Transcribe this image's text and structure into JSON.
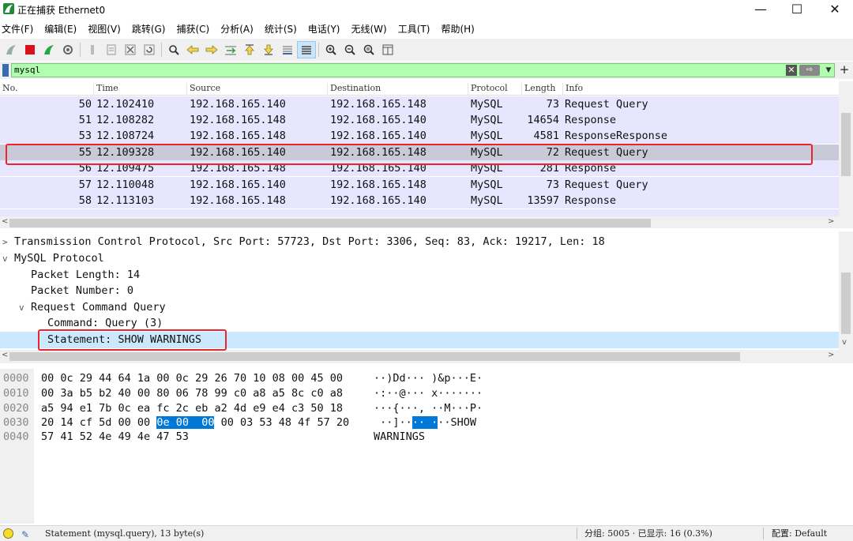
{
  "window": {
    "title": "正在捕获 Ethernet0",
    "minimize": "—",
    "maximize": "☐",
    "close": "✕"
  },
  "menu": [
    "文件(F)",
    "编辑(E)",
    "视图(V)",
    "跳转(G)",
    "捕获(C)",
    "分析(A)",
    "统计(S)",
    "电话(Y)",
    "无线(W)",
    "工具(T)",
    "帮助(H)"
  ],
  "toolbar": {
    "icons": [
      "shark-fin-start-icon",
      "stop-capture-icon",
      "restart-capture-icon",
      "capture-options-icon",
      "open-file-icon",
      "save-file-icon",
      "close-file-icon",
      "reload-icon",
      "find-packet-icon",
      "go-back-icon",
      "go-forward-icon",
      "go-to-packet-icon",
      "first-packet-icon",
      "last-packet-icon",
      "autoscroll-icon",
      "colorize-icon",
      "zoom-in-icon",
      "zoom-out-icon",
      "zoom-normal-icon",
      "resize-columns-icon"
    ]
  },
  "filter": {
    "value": "mysql"
  },
  "packet_list": {
    "columns": [
      "No.",
      "Time",
      "Source",
      "Destination",
      "Protocol",
      "Length",
      "Info"
    ],
    "rows": [
      {
        "no": "50",
        "time": "12.102410",
        "src": "192.168.165.140",
        "dst": "192.168.165.148",
        "proto": "MySQL",
        "len": "73",
        "info": "Request Query"
      },
      {
        "no": "51",
        "time": "12.108282",
        "src": "192.168.165.148",
        "dst": "192.168.165.140",
        "proto": "MySQL",
        "len": "14654",
        "info": "Response"
      },
      {
        "no": "53",
        "time": "12.108724",
        "src": "192.168.165.148",
        "dst": "192.168.165.140",
        "proto": "MySQL",
        "len": "4581",
        "info": "ResponseResponse"
      },
      {
        "no": "55",
        "time": "12.109328",
        "src": "192.168.165.140",
        "dst": "192.168.165.148",
        "proto": "MySQL",
        "len": "72",
        "info": "Request Query"
      },
      {
        "no": "56",
        "time": "12.109475",
        "src": "192.168.165.148",
        "dst": "192.168.165.140",
        "proto": "MySQL",
        "len": "281",
        "info": "Response"
      },
      {
        "no": "57",
        "time": "12.110048",
        "src": "192.168.165.140",
        "dst": "192.168.165.148",
        "proto": "MySQL",
        "len": "73",
        "info": "Request Query"
      },
      {
        "no": "58",
        "time": "12.113103",
        "src": "192.168.165.148",
        "dst": "192.168.165.140",
        "proto": "MySQL",
        "len": "13597",
        "info": "Response"
      }
    ],
    "selected_row": 3
  },
  "details": {
    "lines": [
      {
        "twisty": ">",
        "text": "Transmission Control Protocol, Src Port: 57723, Dst Port: 3306, Seq: 83, Ack: 19217, Len: 18"
      },
      {
        "twisty": "v",
        "text": "MySQL Protocol"
      },
      {
        "twisty": "",
        "text": "Packet Length: 14"
      },
      {
        "twisty": "",
        "text": "Packet Number: 0"
      },
      {
        "twisty": "v",
        "text": "Request Command Query"
      },
      {
        "twisty": "",
        "text": "Command: Query (3)"
      },
      {
        "twisty": "",
        "text": "Statement: SHOW WARNINGS"
      }
    ]
  },
  "bytes": {
    "rows": [
      {
        "offset": "0000",
        "hex_a": "00 0c 29 44 64 1a 00 0c  29 26 70 10 08 00 45 00",
        "hex_hl": "",
        "hex_b": "",
        "ascii_a": "··)Dd··· )&p···E·",
        "ascii_hl": "",
        "ascii_b": ""
      },
      {
        "offset": "0010",
        "hex_a": "00 3a b5 b2 40 00 80 06  78 99 c0 a8 a5 8c c0 a8",
        "hex_hl": "",
        "hex_b": "",
        "ascii_a": "·:··@··· x·······",
        "ascii_hl": "",
        "ascii_b": ""
      },
      {
        "offset": "0020",
        "hex_a": "a5 94 e1 7b 0c ea fc 2c  eb a2 4d e9 e4 c3 50 18",
        "hex_hl": "",
        "hex_b": "",
        "ascii_a": "···{···, ··M···P·",
        "ascii_hl": "",
        "ascii_b": ""
      },
      {
        "offset": "0030",
        "hex_a": "20 14 cf 5d 00 00 ",
        "hex_hl": "0e 00  00",
        "hex_b": " 00 03 53 48 4f 57 20",
        "ascii_a": " ··]··",
        "ascii_hl": "·· ·",
        "ascii_b": "··SHOW "
      },
      {
        "offset": "0040",
        "hex_a": "57 41 52 4e 49 4e 47 53",
        "hex_hl": "",
        "hex_b": "",
        "ascii_a": "WARNINGS",
        "ascii_hl": "",
        "ascii_b": ""
      }
    ]
  },
  "status": {
    "field": "Statement (mysql.query), 13 byte(s)",
    "packets": "分组: 5005 · 已显示: 16 (0.3%)",
    "profile": "配置: Default"
  },
  "colors": {
    "filter_valid": "#afffaf",
    "row_bg": "#e7e6ff",
    "selected_row": "#c9c9d8",
    "annotation_red": "#e8262b",
    "byte_highlight": "#0078d7"
  }
}
